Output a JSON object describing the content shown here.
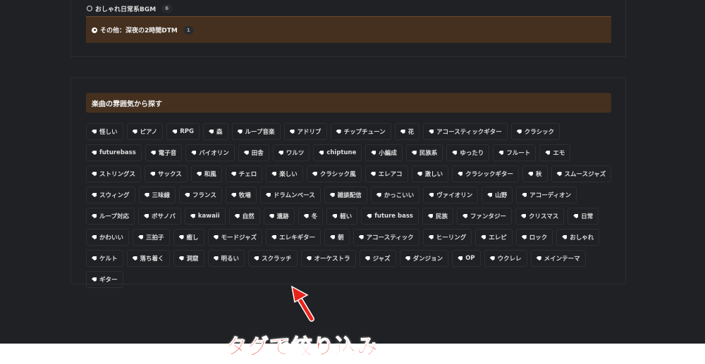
{
  "top_list": {
    "items": [
      {
        "label": "おしゃれ日常系BGM",
        "count": "6",
        "selected": false
      },
      {
        "label": "その他：深夜の2時間DTM",
        "count": "1",
        "selected": true
      }
    ]
  },
  "mood_section": {
    "title": "楽曲の雰囲気から探す",
    "tags": [
      "怪しい",
      "ピアノ",
      "RPG",
      "森",
      "ループ音楽",
      "アドリブ",
      "チップチューン",
      "花",
      "アコースティックギター",
      "クラシック",
      "futurebass",
      "電子音",
      "バイオリン",
      "田舎",
      "ワルツ",
      "chiptune",
      "小編成",
      "民族系",
      "ゆったり",
      "フルート",
      "エモ",
      "ストリングス",
      "サックス",
      "和風",
      "チェロ",
      "楽しい",
      "クラシック風",
      "エレアコ",
      "激しい",
      "クラシックギター",
      "秋",
      "スムースジャズ",
      "スウィング",
      "三味線",
      "フランス",
      "牧場",
      "ドラムンベース",
      "雑談配信",
      "かっこいい",
      "ヴァイオリン",
      "山野",
      "アコーディオン",
      "ループ対応",
      "ボサノバ",
      "kawaii",
      "自然",
      "遺跡",
      "冬",
      "軽い",
      "future bass",
      "民族",
      "ファンタジー",
      "クリスマス",
      "日常",
      "かわいい",
      "三拍子",
      "癒し",
      "モードジャズ",
      "エレキギター",
      "朝",
      "アコースティック",
      "ヒーリング",
      "エレピ",
      "ロック",
      "おしゃれ",
      "ケルト",
      "落ち着く",
      "洞窟",
      "明るい",
      "スクラッチ",
      "オーケストラ",
      "ジャズ",
      "ダンジョン",
      "OP",
      "ウクレレ",
      "メインテーマ",
      "ギター"
    ]
  },
  "annotation": {
    "text": "タグで絞り込み",
    "color": "#e8231a"
  },
  "colors": {
    "background": "#202124",
    "header": "#45301f"
  }
}
